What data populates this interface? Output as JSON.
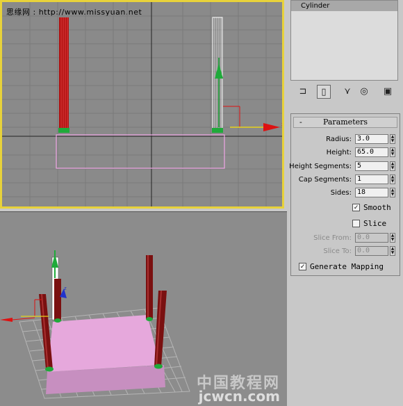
{
  "watermarks": {
    "top": "思缘网 : http://www.missyuan.net",
    "bottom_cn": "中国教程网",
    "bottom_url": "jcwcn.com"
  },
  "object_list": {
    "selected_item": "Cylinder"
  },
  "command_tabs": [
    {
      "name": "create-tab-icon",
      "glyph": "⊐"
    },
    {
      "name": "modify-tab-icon",
      "glyph": "▯"
    },
    {
      "name": "hierarchy-tab-icon",
      "glyph": "⋎"
    },
    {
      "name": "motion-tab-icon",
      "glyph": "◎"
    },
    {
      "name": "display-tab-icon",
      "glyph": "▣"
    }
  ],
  "parameters": {
    "title": "Parameters",
    "collapse_symbol": "-",
    "radius_label": "Radius:",
    "radius_value": "3.0",
    "height_label": "Height:",
    "height_value": "65.0",
    "height_segments_label": "Height Segments:",
    "height_segments_value": "5",
    "cap_segments_label": "Cap Segments:",
    "cap_segments_value": "1",
    "sides_label": "Sides:",
    "sides_value": "18",
    "smooth_label": "Smooth",
    "smooth_checked": true,
    "slice_label": "Slice",
    "slice_checked": false,
    "slice_from_label": "Slice From:",
    "slice_from_value": "0.0",
    "slice_to_label": "Slice To:",
    "slice_to_value": "0.0",
    "generate_mapping_label": "Generate Mapping",
    "generate_mapping_checked": true
  },
  "colors": {
    "viewport_active_border": "#e8d23a",
    "selected_cylinder": "#ffffff",
    "pillar_red": "#7a1010",
    "plane_pink": "#e6a8dc",
    "gizmo_green": "#22aa33",
    "gizmo_red": "#dd1111"
  }
}
